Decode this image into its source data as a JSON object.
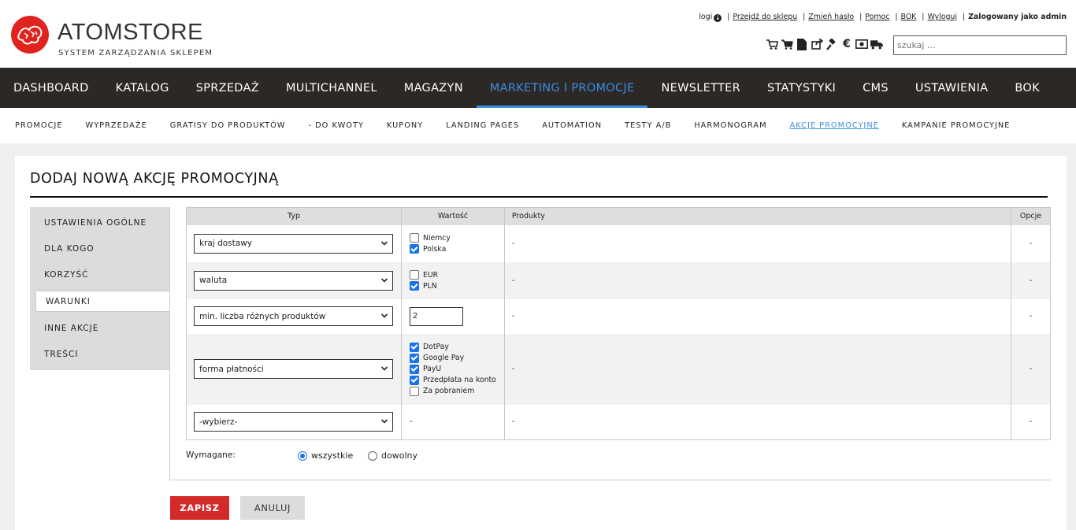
{
  "brand": {
    "title": "ATOMSTORE",
    "subtitle": "SYSTEM ZARZĄDZANIA SKLEPEM"
  },
  "top_links": {
    "logi": "logi",
    "go_to_shop": "Przejdź do sklepu",
    "change_password": "Zmień hasło",
    "help": "Pomoc",
    "bok": "BOK",
    "logout": "Wyloguj",
    "logged_in": "Zalogowany jako admin"
  },
  "search": {
    "placeholder": "szukaj ..."
  },
  "main_nav": [
    "DASHBOARD",
    "KATALOG",
    "SPRZEDAŻ",
    "MULTICHANNEL",
    "MAGAZYN",
    "MARKETING I PROMOCJE",
    "NEWSLETTER",
    "STATYSTYKI",
    "CMS",
    "USTAWIENIA",
    "BOK"
  ],
  "main_nav_active": "MARKETING I PROMOCJE",
  "sub_nav": [
    "PROMOCJE",
    "WYPRZEDAŻE",
    "GRATISY DO PRODUKTÓW",
    "- DO KWOTY",
    "KUPONY",
    "LANDING PAGES",
    "AUTOMATION",
    "TESTY A/B",
    "HARMONOGRAM",
    "AKCJE PROMOCYJNE",
    "KAMPANIE PROMOCYJNE"
  ],
  "sub_nav_active": "AKCJE PROMOCYJNE",
  "page_title": "DODAJ NOWĄ AKCJĘ PROMOCYJNĄ",
  "sidebar": [
    "USTAWIENIA OGÓLNE",
    "DLA KOGO",
    "KORZYŚĆ",
    "WARUNKI",
    "INNE AKCJE",
    "TREŚCI"
  ],
  "sidebar_active": "WARUNKI",
  "table": {
    "headers": {
      "type": "Typ",
      "value": "Wartość",
      "products": "Produkty",
      "options": "Opcje"
    },
    "rows": [
      {
        "type": "kraj dostawy",
        "checkboxes": [
          {
            "label": "Niemcy",
            "checked": false
          },
          {
            "label": "Polska",
            "checked": true
          }
        ],
        "products": "-",
        "options": "-"
      },
      {
        "type": "waluta",
        "checkboxes": [
          {
            "label": "EUR",
            "checked": false
          },
          {
            "label": "PLN",
            "checked": true
          }
        ],
        "products": "-",
        "options": "-"
      },
      {
        "type": "min. liczba różnych produktów",
        "input_value": "2",
        "products": "-",
        "options": "-"
      },
      {
        "type": "forma płatności",
        "checkboxes": [
          {
            "label": "DotPay",
            "checked": true
          },
          {
            "label": "Google Pay",
            "checked": true
          },
          {
            "label": "PayU",
            "checked": true
          },
          {
            "label": "Przedpłata na konto",
            "checked": true
          },
          {
            "label": "Za pobraniem",
            "checked": false
          }
        ],
        "products": "-",
        "options": "-"
      },
      {
        "type": "-wybierz-",
        "value_text": "-",
        "products": "-",
        "options": "-"
      }
    ]
  },
  "required": {
    "label": "Wymagane:",
    "options": [
      "wszystkie",
      "dowolny"
    ],
    "selected": "wszystkie"
  },
  "buttons": {
    "save": "ZAPISZ",
    "cancel": "ANULUJ"
  },
  "colors": {
    "accent": "#3b8fe3",
    "nav_bg": "#2c2826",
    "save_bg": "#d32a2a",
    "brand_red": "#e1231e"
  }
}
